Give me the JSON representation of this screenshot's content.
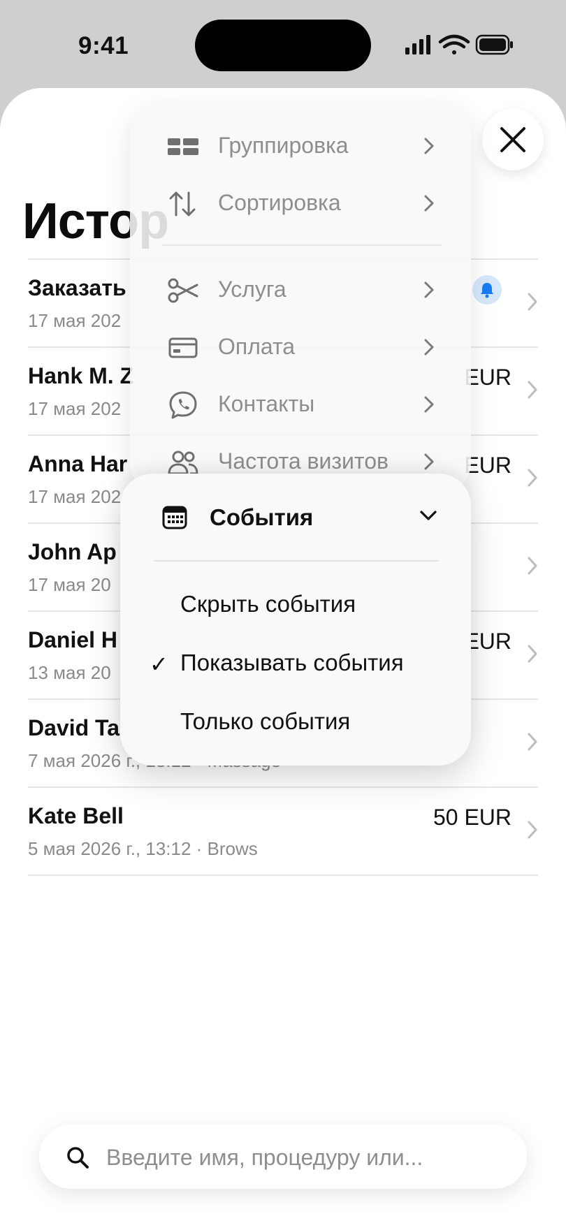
{
  "status_bar": {
    "time": "9:41"
  },
  "header": {
    "title": "Истор"
  },
  "list": [
    {
      "name": "Заказать",
      "meta": "17 мая 202",
      "price": "",
      "has_bell": true
    },
    {
      "name": "Hank M. Z",
      "meta": "17 мая 202",
      "price": "EUR",
      "has_bell": false
    },
    {
      "name": "Anna Har",
      "meta": "17 мая 202",
      "price": "EUR",
      "has_bell": false
    },
    {
      "name": "John Ap",
      "meta": "17 мая 20",
      "price": "",
      "has_bell": false
    },
    {
      "name": "Daniel H",
      "meta": "13 мая 20",
      "price": "EUR",
      "has_bell": false
    },
    {
      "name": "David Ta",
      "meta": "7 мая 2026 г., 13:12 · Massage",
      "price": "",
      "has_bell": false
    },
    {
      "name": "Kate Bell",
      "meta": "5 мая 2026 г., 13:12 · Brows",
      "price": "50 EUR",
      "has_bell": false
    }
  ],
  "menu": {
    "items": [
      {
        "label": "Группировка",
        "icon": "grid-icon"
      },
      {
        "label": "Сортировка",
        "icon": "sort-icon"
      },
      {
        "label": "Услуга",
        "icon": "scissors-icon"
      },
      {
        "label": "Оплата",
        "icon": "card-icon"
      },
      {
        "label": "Контакты",
        "icon": "chat-phone-icon"
      },
      {
        "label": "Частота визитов",
        "icon": "people-icon"
      }
    ],
    "events": {
      "title": "События",
      "options": [
        {
          "label": "Скрыть события",
          "checked": false
        },
        {
          "label": "Показывать события",
          "checked": true
        },
        {
          "label": "Только события",
          "checked": false
        }
      ],
      "check_mark": "✓"
    }
  },
  "search": {
    "placeholder": "Введите имя, процедуру или..."
  }
}
